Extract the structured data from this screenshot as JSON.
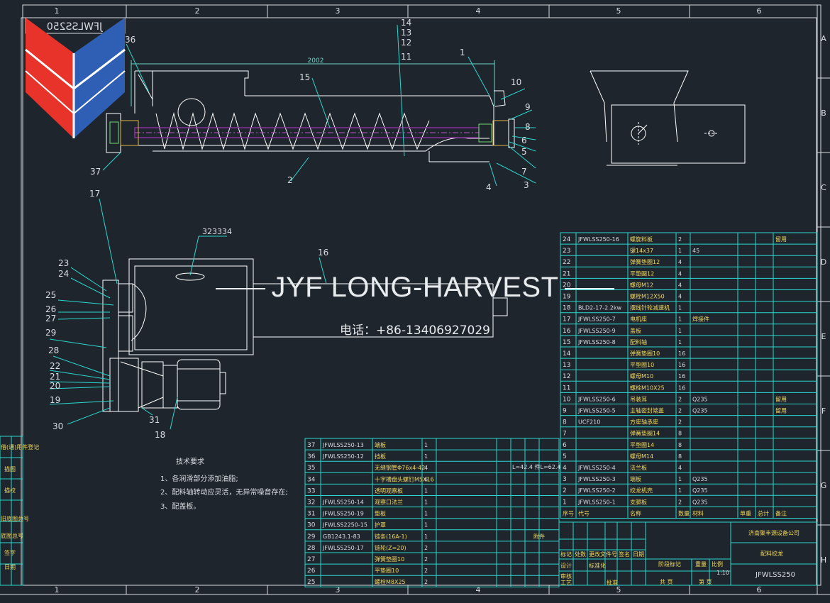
{
  "drawing": {
    "code": "JFWLSS250",
    "code_mirrored": "JFWLSS250",
    "top_dimension": "2002",
    "port_label": "323334",
    "length_note": "L=42.4  件L=62.4",
    "col_markers": [
      "1",
      "2",
      "3",
      "4",
      "5",
      "6"
    ],
    "row_markers": [
      "A",
      "B",
      "C",
      "D",
      "E",
      "F",
      "G",
      "H"
    ],
    "balloons_top": [
      "1",
      "2",
      "3",
      "4",
      "5",
      "6",
      "7",
      "8",
      "9",
      "10",
      "11",
      "12",
      "13",
      "14",
      "15",
      "36",
      "37"
    ],
    "balloons_side": [
      "16",
      "17",
      "18",
      "19",
      "20",
      "21",
      "22",
      "23",
      "24",
      "25",
      "26",
      "27",
      "28",
      "29",
      "30",
      "31"
    ]
  },
  "watermark": {
    "title": "JYF LONG-HARVEST",
    "phone": "电话：+86-13406927029"
  },
  "tech_notes": {
    "heading": "技术要求",
    "items": [
      "1、各润滑部分添加油脂;",
      "2、配料轴转动应灵活，无异常噪音存在;",
      "3、配盖板。"
    ]
  },
  "colors": {
    "background": "#1f252c",
    "line": "#ffffff",
    "table": "#2ad8d0",
    "dim": "#6bd5c8",
    "red": "#e8332a",
    "blue": "#2f5fb5",
    "shaft": "#8b2fa0"
  },
  "bom_right": {
    "rows": [
      [
        "24",
        "JFWLSS250-16",
        "螺旋料板",
        "2",
        "",
        "",
        "",
        "留用"
      ],
      [
        "23",
        "",
        "键14x37",
        "1",
        "45",
        "",
        "",
        ""
      ],
      [
        "22",
        "",
        "弹簧垫圈12",
        "4",
        "",
        "",
        "",
        ""
      ],
      [
        "21",
        "",
        "平垫圈12",
        "4",
        "",
        "",
        "",
        ""
      ],
      [
        "20",
        "",
        "螺母M12",
        "4",
        "",
        "",
        "",
        ""
      ],
      [
        "19",
        "",
        "螺栓M12X50",
        "4",
        "",
        "",
        "",
        ""
      ],
      [
        "18",
        "BLD2-17-2.2kw",
        "摆线针轮减速机",
        "1",
        "",
        "",
        "",
        ""
      ],
      [
        "17",
        "JFWLSS250-7",
        "电机座",
        "1",
        "焊接件",
        "",
        "",
        ""
      ],
      [
        "16",
        "JFWLSS250-9",
        "盖板",
        "1",
        "",
        "",
        "",
        ""
      ],
      [
        "15",
        "JFWLSS250-8",
        "配料轴",
        "1",
        "",
        "",
        "",
        ""
      ],
      [
        "14",
        "",
        "弹簧垫圈10",
        "16",
        "",
        "",
        "",
        ""
      ],
      [
        "13",
        "",
        "平垫圈10",
        "16",
        "",
        "",
        "",
        ""
      ],
      [
        "12",
        "",
        "螺母M10",
        "16",
        "",
        "",
        "",
        ""
      ],
      [
        "11",
        "",
        "螺栓M10X25",
        "16",
        "",
        "",
        "",
        ""
      ],
      [
        "10",
        "JFWLSS250-6",
        "吊装耳",
        "2",
        "Q235",
        "",
        "",
        "留用"
      ],
      [
        "9",
        "JFWLSS250-5",
        "主轴密封端盖",
        "2",
        "Q235",
        "",
        "",
        "留用"
      ],
      [
        "8",
        "UCF210",
        "方座轴承座",
        "2",
        "",
        "",
        "",
        ""
      ],
      [
        "7",
        "",
        "弹簧垫圈14",
        "8",
        "",
        "",
        "",
        ""
      ],
      [
        "6",
        "",
        "平垫圈14",
        "8",
        "",
        "",
        "",
        ""
      ],
      [
        "5",
        "",
        "螺母M14",
        "8",
        "",
        "",
        "",
        ""
      ],
      [
        "4",
        "JFWLSS250-4",
        "法兰板",
        "4",
        "",
        "",
        "",
        ""
      ],
      [
        "3",
        "JFWLSS250-3",
        "端板",
        "1",
        "Q235",
        "",
        "",
        ""
      ],
      [
        "2",
        "JFWLSS250-2",
        "绞龙机壳",
        "1",
        "Q235",
        "",
        "",
        ""
      ],
      [
        "1",
        "JFWLSS250-1",
        "支腿板",
        "2",
        "Q235",
        "",
        "",
        ""
      ]
    ],
    "header": [
      "序号",
      "代号",
      "名称",
      "数量",
      "材料",
      "单重",
      "总计",
      "备注"
    ]
  },
  "bom_left": {
    "rows": [
      [
        "37",
        "JFWLSS250-13",
        "端板",
        "1",
        ""
      ],
      [
        "36",
        "JFWLSS250-12",
        "挡板",
        "1",
        ""
      ],
      [
        "35",
        "",
        "无缝钢管Φ76x4-42",
        "4",
        ""
      ],
      [
        "34",
        "",
        "十字槽盘头螺钉M5X16",
        "6",
        ""
      ],
      [
        "33",
        "",
        "透明观察板",
        "1",
        ""
      ],
      [
        "32",
        "JFWLSS250-14",
        "观察口法兰",
        "1",
        ""
      ],
      [
        "31",
        "JFWLSS250-19",
        "垫板",
        "1",
        ""
      ],
      [
        "30",
        "JFWLSS2250-15",
        "护罩",
        "1",
        ""
      ],
      [
        "29",
        "GB1243.1-83",
        "链条(16A-1)",
        "1",
        "附件"
      ],
      [
        "28",
        "JFWLSS250-17",
        "链轮(Z=20)",
        "2",
        ""
      ],
      [
        "27",
        "",
        "弹簧垫圈10",
        "2",
        ""
      ],
      [
        "26",
        "",
        "平垫圈10",
        "2",
        ""
      ],
      [
        "25",
        "",
        "螺栓M8X25",
        "2",
        ""
      ]
    ]
  },
  "title_block": {
    "company": "济南聚丰源设备公司",
    "name": "配料绞龙",
    "code": "JFWLSS250",
    "scale": "1:10",
    "labels": [
      "标记",
      "处数",
      "更改文件号",
      "签名",
      "日期",
      "设计",
      "标准化",
      "审核",
      "工艺",
      "批准",
      "阶段标记",
      "重量",
      "比例",
      "共 页",
      "第 页"
    ]
  },
  "left_edge_labels": [
    "借(通)用件登记",
    "描图",
    "描校",
    "旧底图总号",
    "底图总号",
    "签字",
    "日期"
  ]
}
